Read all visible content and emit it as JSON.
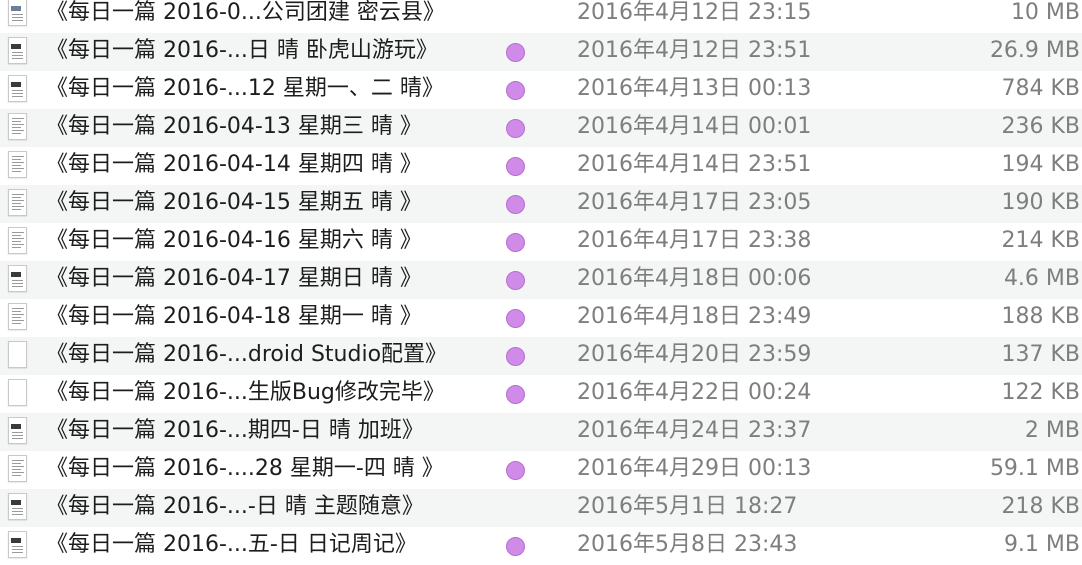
{
  "files": [
    {
      "name": "《每日一篇 2016-0...公司团建 密云县》",
      "date": "2016年4月12日 23:15",
      "size": "10 MB",
      "tag": false,
      "icon": "document-image-icon"
    },
    {
      "name": "《每日一篇 2016-...日 晴 卧虎山游玩》",
      "date": "2016年4月12日 23:51",
      "size": "26.9 MB",
      "tag": true,
      "icon": "document-image-icon"
    },
    {
      "name": "《每日一篇 2016-...12 星期一、二 晴》",
      "date": "2016年4月13日 00:13",
      "size": "784 KB",
      "tag": true,
      "icon": "document-image-icon"
    },
    {
      "name": "《每日一篇 2016-04-13 星期三 晴 》",
      "date": "2016年4月14日 00:01",
      "size": "236 KB",
      "tag": true,
      "icon": "document-text-icon"
    },
    {
      "name": "《每日一篇 2016-04-14 星期四 晴 》",
      "date": "2016年4月14日 23:51",
      "size": "194 KB",
      "tag": true,
      "icon": "document-text-icon"
    },
    {
      "name": "《每日一篇 2016-04-15 星期五 晴 》",
      "date": "2016年4月17日 23:05",
      "size": "190 KB",
      "tag": true,
      "icon": "document-text-icon"
    },
    {
      "name": "《每日一篇 2016-04-16 星期六 晴 》",
      "date": "2016年4月17日 23:38",
      "size": "214 KB",
      "tag": true,
      "icon": "document-text-icon"
    },
    {
      "name": "《每日一篇 2016-04-17 星期日 晴 》",
      "date": "2016年4月18日 00:06",
      "size": "4.6 MB",
      "tag": true,
      "icon": "document-image-icon"
    },
    {
      "name": "《每日一篇 2016-04-18 星期一 晴 》",
      "date": "2016年4月18日 23:49",
      "size": "188 KB",
      "tag": true,
      "icon": "document-text-icon"
    },
    {
      "name": "《每日一篇 2016-...droid Studio配置》",
      "date": "2016年4月20日 23:59",
      "size": "137 KB",
      "tag": true,
      "icon": "document-blank-icon"
    },
    {
      "name": "《每日一篇 2016-...生版Bug修改完毕》",
      "date": "2016年4月22日 00:24",
      "size": "122 KB",
      "tag": true,
      "icon": "document-blank-icon"
    },
    {
      "name": "《每日一篇 2016-...期四-日 晴 加班》",
      "date": "2016年4月24日 23:37",
      "size": "2 MB",
      "tag": false,
      "icon": "document-image-icon"
    },
    {
      "name": "《每日一篇 2016-....28 星期一-四 晴 》",
      "date": "2016年4月29日 00:13",
      "size": "59.1 MB",
      "tag": true,
      "icon": "document-text-icon"
    },
    {
      "name": "《每日一篇 2016-...-日 晴 主题随意》",
      "date": "2016年5月1日 18:27",
      "size": "218 KB",
      "tag": false,
      "icon": "document-image-icon"
    },
    {
      "name": "《每日一篇 2016-...五-日 日记周记》",
      "date": "2016年5月8日 23:43",
      "size": "9.1 MB",
      "tag": true,
      "icon": "document-image-icon"
    }
  ],
  "colors": {
    "tag_purple": "#d08be8",
    "row_alt_bg": "#f4f5f5",
    "name_text": "#1d1d1d",
    "meta_text": "#7e7e7e"
  }
}
